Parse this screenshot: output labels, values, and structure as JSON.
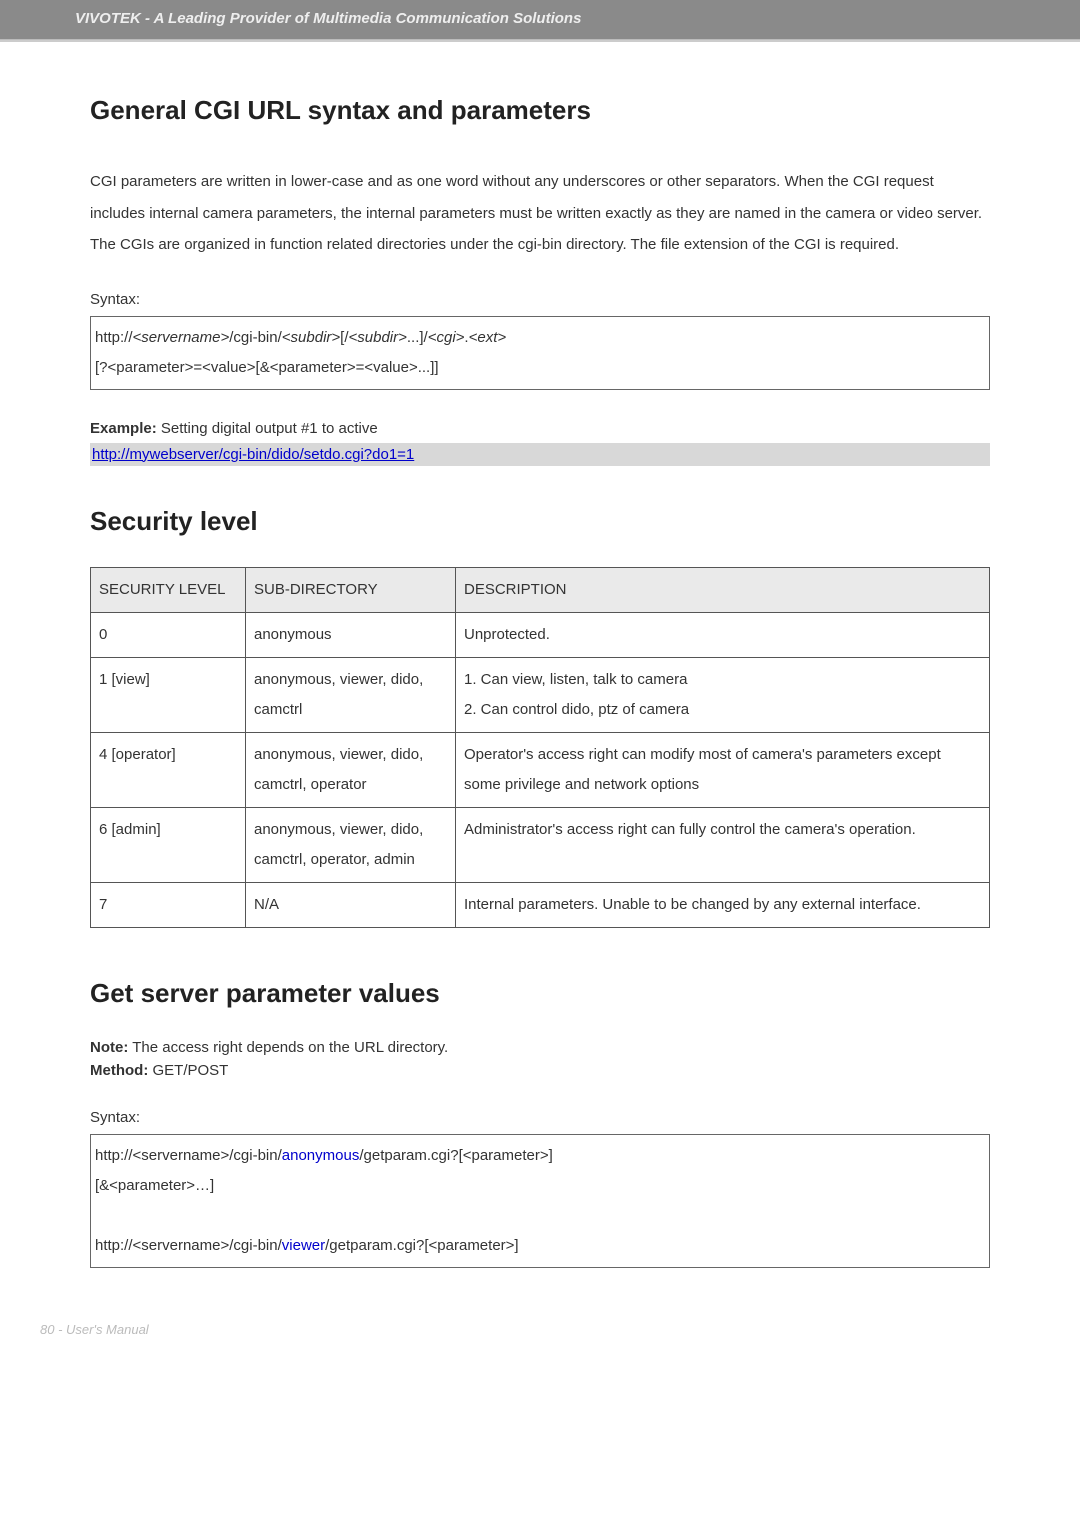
{
  "header": {
    "tagline": "VIVOTEK - A Leading Provider of Multimedia Communication Solutions"
  },
  "section_general": {
    "heading": "General CGI URL syntax and parameters",
    "paragraph": "CGI parameters are written in lower-case and as one word without any underscores or other separators. When the CGI request includes internal camera parameters, the internal parameters must be written exactly as they are named in the camera or video server. The CGIs are organized in function related directories under the cgi-bin directory. The file extension of the CGI is required.",
    "syntax_label": "Syntax:",
    "syntax_line1_prefix": "http://",
    "syntax_line1_servername": "<servername>",
    "syntax_line1_mid1": "/cgi-bin/",
    "syntax_line1_subdir1": "<subdir>",
    "syntax_line1_mid2": "[/",
    "syntax_line1_subdir2": "<subdir>",
    "syntax_line1_mid3": "...]/",
    "syntax_line1_cgi": "<cgi>",
    "syntax_line1_dot": ".",
    "syntax_line1_ext": "<ext>",
    "syntax_line2": "[?<parameter>=<value>[&<parameter>=<value>...]]",
    "example_label": "Example:",
    "example_text": " Setting digital output #1 to active",
    "example_link": "http://mywebserver/cgi-bin/dido/setdo.cgi?do1=1"
  },
  "section_security": {
    "heading": "Security level",
    "table": {
      "headers": [
        "SECURITY LEVEL",
        "SUB-DIRECTORY",
        "DESCRIPTION"
      ],
      "rows": [
        {
          "level": "0",
          "subdir": "anonymous",
          "desc": "Unprotected."
        },
        {
          "level": "1 [view]",
          "subdir": "anonymous, viewer, dido, camctrl",
          "desc": "1. Can view, listen, talk to camera\n2. Can control dido, ptz of camera"
        },
        {
          "level": "4 [operator]",
          "subdir": "anonymous, viewer, dido, camctrl, operator",
          "desc": "Operator's access right can modify most of camera's parameters except some privilege and network options"
        },
        {
          "level": "6 [admin]",
          "subdir": "anonymous, viewer, dido, camctrl, operator, admin",
          "desc": "Administrator's access right can fully control the camera's operation."
        },
        {
          "level": "7",
          "subdir": "N/A",
          "desc": "Internal parameters. Unable to be changed by any external interface."
        }
      ]
    }
  },
  "section_get": {
    "heading": "Get server parameter values",
    "note_label": "Note:",
    "note_text": " The access right depends on the URL directory.",
    "method_label": "Method:",
    "method_text": " GET/POST",
    "syntax_label": "Syntax:",
    "code1_prefix": "http://",
    "code1_servername": "<servername>",
    "code1_mid1": "/cgi-bin/",
    "code1_anon": "anonymous",
    "code1_mid2": "/getparam.cgi?[",
    "code1_param": "<parameter>",
    "code1_suffix": "]",
    "code1_line2": "[&<parameter>…]",
    "code2_prefix": "http://",
    "code2_servername": "<servername>",
    "code2_mid1": "/cgi-bin/",
    "code2_viewer": "viewer",
    "code2_mid2": "/getparam.cgi?[",
    "code2_param": "<parameter>",
    "code2_suffix": "]"
  },
  "footer": {
    "page": "80 - User's Manual"
  }
}
